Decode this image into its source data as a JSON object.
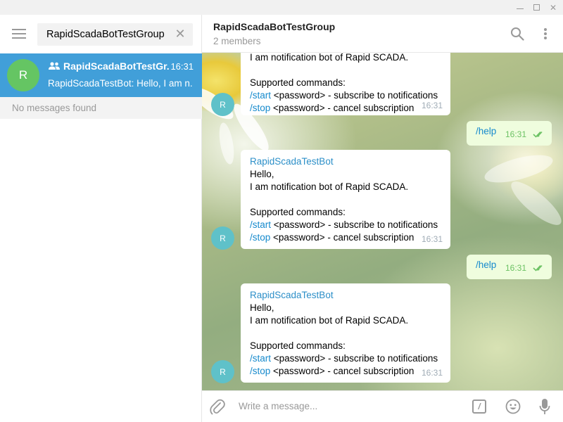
{
  "window": {
    "minimize": "—",
    "maximize": "□",
    "close": "✕"
  },
  "sidebar": {
    "search_value": "RapidScadaBotTestGroup",
    "chat": {
      "avatar_letter": "R",
      "title": "RapidScadaBotTestGr...",
      "time": "16:31",
      "preview": "RapidScadaTestBot: Hello, I am n..."
    },
    "no_messages": "No messages found"
  },
  "header": {
    "title": "RapidScadaBotTestGroup",
    "subtitle": "2 members"
  },
  "messages": [
    {
      "type": "in-partial",
      "avatar": "R",
      "line0": "I am notification bot of Rapid SCADA.",
      "line_blank": "",
      "supported": "Supported commands:",
      "start_cmd": "/start",
      "start_desc": " <password> - subscribe to notifications",
      "stop_cmd": "/stop",
      "stop_desc": " <password> - cancel subscription",
      "time": "16:31"
    },
    {
      "type": "out",
      "text": "/help",
      "time": "16:31"
    },
    {
      "type": "in",
      "avatar": "R",
      "sender": "RapidScadaTestBot",
      "hello": "Hello,",
      "line0": "I am notification bot of Rapid SCADA.",
      "supported": "Supported commands:",
      "start_cmd": "/start",
      "start_desc": " <password> - subscribe to notifications",
      "stop_cmd": "/stop",
      "stop_desc": " <password> - cancel subscription",
      "time": "16:31"
    },
    {
      "type": "out",
      "text": "/help",
      "time": "16:31"
    },
    {
      "type": "in",
      "avatar": "R",
      "sender": "RapidScadaTestBot",
      "hello": "Hello,",
      "line0": "I am notification bot of Rapid SCADA.",
      "supported": "Supported commands:",
      "start_cmd": "/start",
      "start_desc": " <password> - subscribe to notifications",
      "stop_cmd": "/stop",
      "stop_desc": " <password> - cancel subscription",
      "time": "16:31"
    }
  ],
  "composer": {
    "placeholder": "Write a message...",
    "bot_command_glyph": "/"
  },
  "colors": {
    "accent": "#419fd9",
    "link": "#168acd",
    "outgoing_bubble": "#effdde",
    "avatar_green": "#65c563",
    "avatar_teal": "#5fc1c9"
  }
}
